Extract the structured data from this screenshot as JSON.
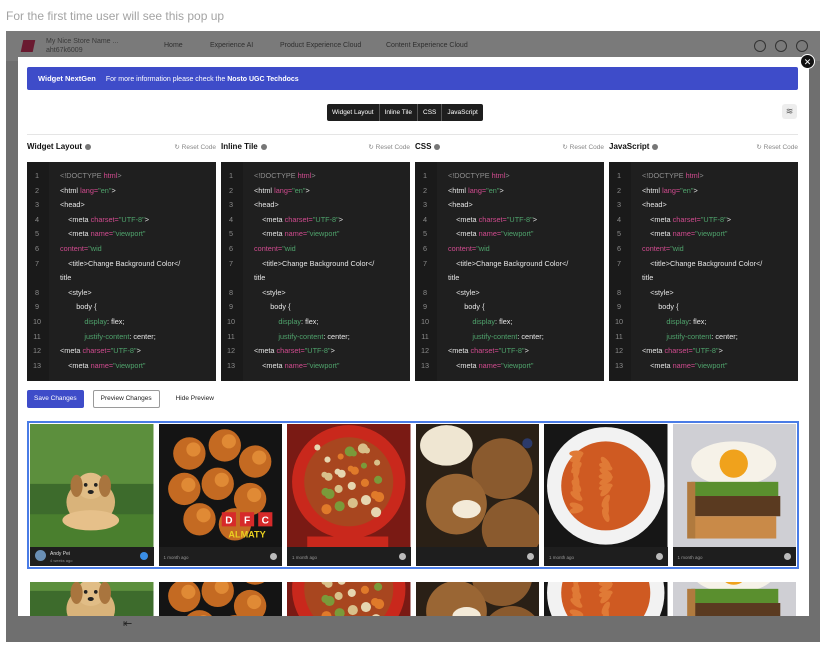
{
  "caption": "For the first time user will see this pop up",
  "app": {
    "store_name": "My Nice Store Name ...",
    "store_id": "aht67k6009",
    "nav": [
      "Home",
      "Experience AI",
      "Product Experience Cloud",
      "Content Experience Cloud"
    ]
  },
  "modal": {
    "banner_title": "Widget NextGen",
    "banner_text": "For more information please check the",
    "banner_link": "Nosto UGC Techdocs",
    "tabs": [
      "Widget Layout",
      "Inline Tile",
      "CSS",
      "JavaScript"
    ],
    "reset_label": "Reset Code",
    "editors": [
      {
        "title": "Widget Layout"
      },
      {
        "title": "Inline Tile"
      },
      {
        "title": "CSS"
      },
      {
        "title": "JavaScript"
      }
    ],
    "code_lines": [
      {
        "n": "1",
        "parts": [
          [
            "<!DOCTYPE ",
            "gray"
          ],
          [
            "html",
            "pink"
          ],
          [
            ">",
            "gray"
          ]
        ]
      },
      {
        "n": "2",
        "parts": [
          [
            "<html ",
            "white"
          ],
          [
            "lang=",
            "pink"
          ],
          [
            "\"en\"",
            "green"
          ],
          [
            ">",
            "white"
          ]
        ]
      },
      {
        "n": "3",
        "parts": [
          [
            "<head>",
            "white"
          ]
        ]
      },
      {
        "n": "4",
        "parts": [
          [
            "    <meta ",
            "white"
          ],
          [
            "charset=",
            "pink"
          ],
          [
            "\"UTF-8\"",
            "green"
          ],
          [
            ">",
            "white"
          ]
        ]
      },
      {
        "n": "5",
        "parts": [
          [
            "    <meta ",
            "white"
          ],
          [
            "name=",
            "pink"
          ],
          [
            "\"viewport\"",
            "green"
          ]
        ]
      },
      {
        "n": "6",
        "parts": [
          [
            "content=",
            "pink"
          ],
          [
            "\"wid",
            "green"
          ]
        ]
      },
      {
        "n": "7",
        "parts": [
          [
            "    <title>Change Background Color</",
            "white"
          ]
        ]
      },
      {
        "n": "",
        "parts": [
          [
            "title",
            "white"
          ]
        ]
      },
      {
        "n": "8",
        "parts": [
          [
            "    <style>",
            "white"
          ]
        ]
      },
      {
        "n": "9",
        "parts": [
          [
            "        body {",
            "white"
          ]
        ]
      },
      {
        "n": "10",
        "parts": [
          [
            "            display",
            "green"
          ],
          [
            ": flex;",
            "white"
          ]
        ]
      },
      {
        "n": "11",
        "parts": [
          [
            "            justify-content",
            "green"
          ],
          [
            ": center;",
            "white"
          ]
        ]
      },
      {
        "n": "12",
        "parts": [
          [
            "<meta ",
            "white"
          ],
          [
            "charset=",
            "pink"
          ],
          [
            "\"UTF-8\"",
            "green"
          ],
          [
            ">",
            "white"
          ]
        ]
      },
      {
        "n": "13",
        "parts": [
          [
            "    <meta ",
            "white"
          ],
          [
            "name=",
            "pink"
          ],
          [
            "\"viewport\"",
            "green"
          ]
        ]
      }
    ],
    "buttons": {
      "save": "Save Changes",
      "preview": "Preview Changes",
      "hide": "Hide Preview"
    },
    "tiles": [
      {
        "scene": "puppy",
        "user": "Andy Pei",
        "ago": "4 weeks ago"
      },
      {
        "scene": "chicken",
        "ago": "1 month ago",
        "sign": "DFC",
        "sign2": "ALMATY"
      },
      {
        "scene": "soup",
        "ago": "1 month ago"
      },
      {
        "scene": "muffins",
        "ago": ""
      },
      {
        "scene": "pasta",
        "ago": "1 month ago"
      },
      {
        "scene": "burger",
        "ago": "1 month ago"
      }
    ]
  }
}
